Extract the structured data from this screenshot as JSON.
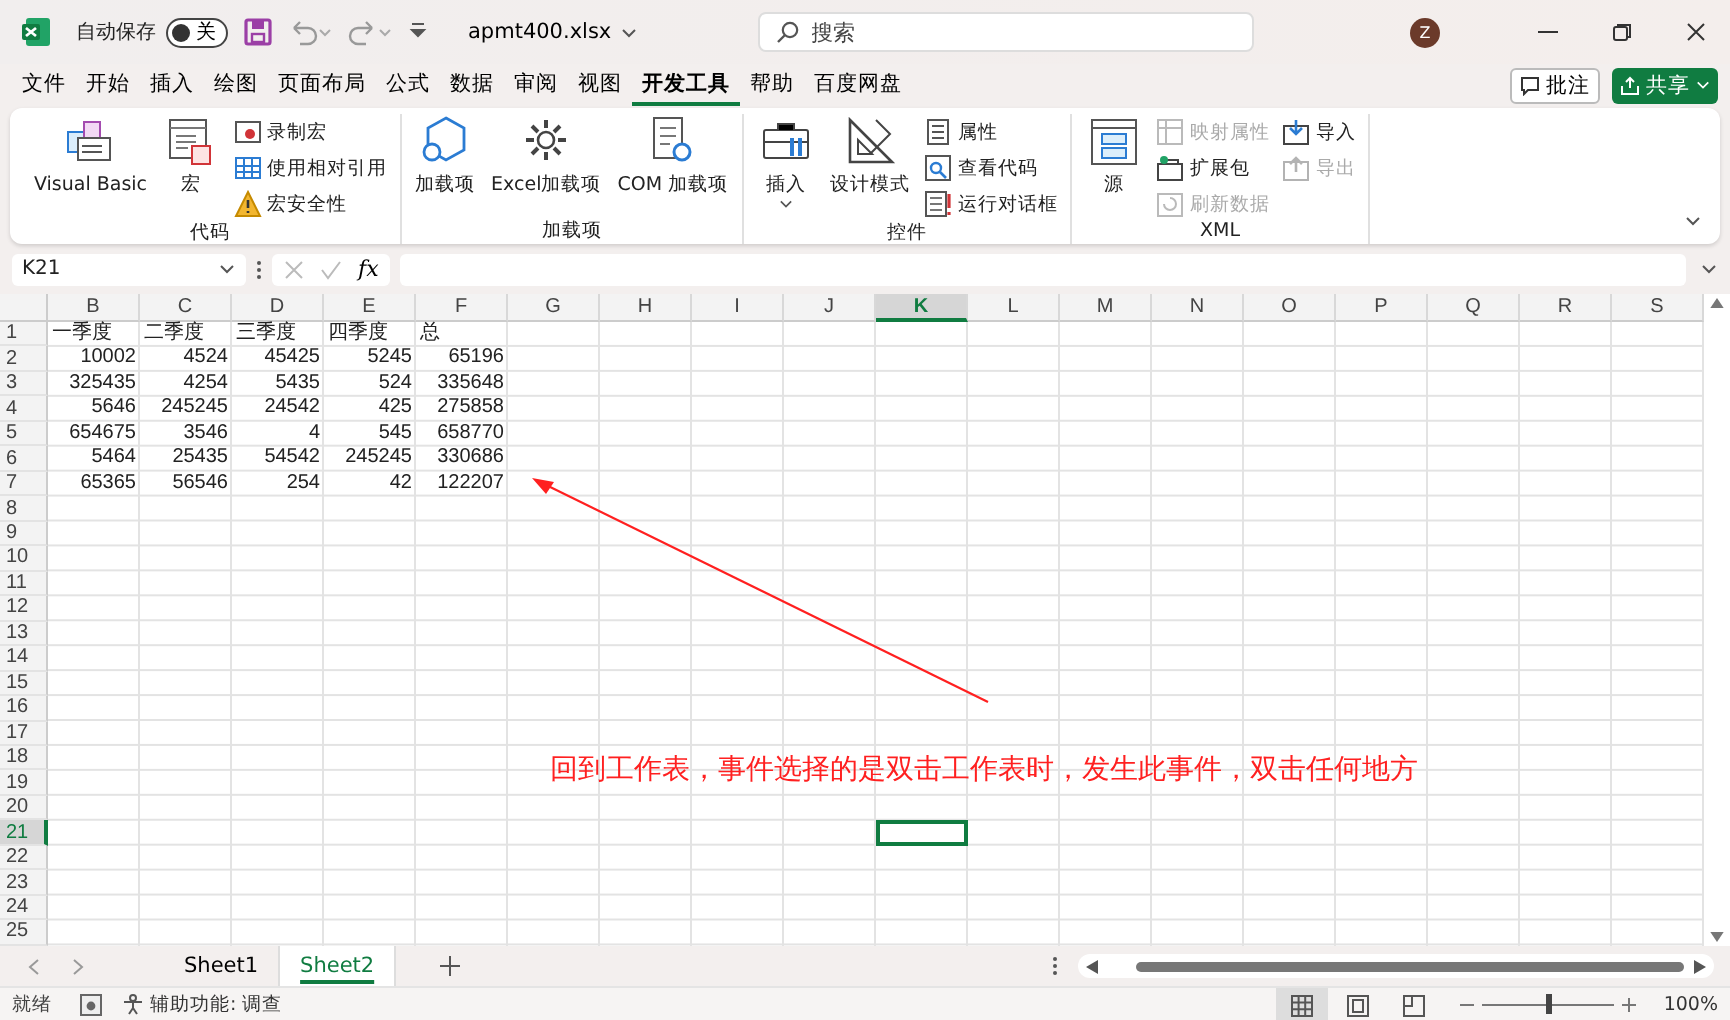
{
  "title_bar": {
    "autosave_label": "自动保存",
    "autosave_toggle": {
      "label": "关",
      "on": false
    },
    "file_name": "apmt400.xlsx",
    "search": {
      "placeholder": "搜索"
    },
    "avatar": "Z"
  },
  "menu_tabs": [
    {
      "label": "文件",
      "selected": false
    },
    {
      "label": "开始",
      "selected": false
    },
    {
      "label": "插入",
      "selected": false
    },
    {
      "label": "绘图",
      "selected": false
    },
    {
      "label": "页面布局",
      "selected": false
    },
    {
      "label": "公式",
      "selected": false
    },
    {
      "label": "数据",
      "selected": false
    },
    {
      "label": "审阅",
      "selected": false
    },
    {
      "label": "视图",
      "selected": false
    },
    {
      "label": "开发工具",
      "selected": true
    },
    {
      "label": "帮助",
      "selected": false
    },
    {
      "label": "百度网盘",
      "selected": false
    }
  ],
  "comment_button": "批注",
  "share_button": "共享",
  "ribbon": [
    {
      "title": "代码",
      "items": [
        {
          "kind": "large",
          "lines": [
            "Visual Basic"
          ],
          "disabled": false
        },
        {
          "kind": "large",
          "lines": [
            "宏"
          ],
          "disabled": false
        },
        {
          "kind": "small",
          "label": "录制宏",
          "disabled": false
        },
        {
          "kind": "small",
          "label": "使用相对引用",
          "disabled": false
        },
        {
          "kind": "small",
          "label": "宏安全性",
          "disabled": false
        }
      ]
    },
    {
      "title": "加载项",
      "items": [
        {
          "kind": "large",
          "lines": [
            "加",
            "载项"
          ],
          "disabled": false
        },
        {
          "kind": "large",
          "lines": [
            "Excel",
            "加载项"
          ],
          "disabled": false
        },
        {
          "kind": "large",
          "lines": [
            "COM 加载项"
          ],
          "disabled": false
        }
      ]
    },
    {
      "title": "控件",
      "items": [
        {
          "kind": "menu",
          "lines": [
            "插入"
          ],
          "disabled": false
        },
        {
          "kind": "large",
          "lines": [
            "设计模式"
          ],
          "disabled": false
        },
        {
          "kind": "small",
          "label": "属性",
          "disabled": false
        },
        {
          "kind": "small",
          "label": "查看代码",
          "disabled": false
        },
        {
          "kind": "small",
          "label": "运行对话框",
          "disabled": false
        }
      ]
    },
    {
      "title": "XML",
      "items": [
        {
          "kind": "large",
          "lines": [
            "源"
          ],
          "disabled": false
        },
        {
          "kind": "small",
          "label": "映射属性",
          "disabled": true
        },
        {
          "kind": "small",
          "label": "扩展包",
          "disabled": false
        },
        {
          "kind": "small",
          "label": "刷新数据",
          "disabled": true
        },
        {
          "kind": "small",
          "label": "导入",
          "disabled": false
        },
        {
          "kind": "small",
          "label": "导出",
          "disabled": true
        }
      ]
    }
  ],
  "formula_bar": {
    "name_box": "K21",
    "function_label": "fx"
  },
  "columns": [
    {
      "label": "B",
      "selected": false
    },
    {
      "label": "C",
      "selected": false
    },
    {
      "label": "D",
      "selected": false
    },
    {
      "label": "E",
      "selected": false
    },
    {
      "label": "F",
      "selected": false
    },
    {
      "label": "G",
      "selected": false
    },
    {
      "label": "H",
      "selected": false
    },
    {
      "label": "I",
      "selected": false
    },
    {
      "label": "J",
      "selected": false
    },
    {
      "label": "K",
      "selected": true
    },
    {
      "label": "L",
      "selected": false
    },
    {
      "label": "M",
      "selected": false
    },
    {
      "label": "N",
      "selected": false
    },
    {
      "label": "O",
      "selected": false
    },
    {
      "label": "P",
      "selected": false
    },
    {
      "label": "Q",
      "selected": false
    },
    {
      "label": "R",
      "selected": false
    },
    {
      "label": "S",
      "selected": false
    }
  ],
  "rows": [
    {
      "label": "1",
      "selected": false,
      "kind": "text",
      "cells": [
        "一季度",
        "二季度",
        "三季度",
        "四季度",
        "总"
      ]
    },
    {
      "label": "2",
      "selected": false,
      "kind": "number",
      "cells": [
        "10002",
        "4524",
        "45425",
        "5245",
        "65196"
      ]
    },
    {
      "label": "3",
      "selected": false,
      "kind": "number",
      "cells": [
        "325435",
        "4254",
        "5435",
        "524",
        "335648"
      ]
    },
    {
      "label": "4",
      "selected": false,
      "kind": "number",
      "cells": [
        "5646",
        "245245",
        "24542",
        "425",
        "275858"
      ]
    },
    {
      "label": "5",
      "selected": false,
      "kind": "number",
      "cells": [
        "654675",
        "3546",
        "4",
        "545",
        "658770"
      ]
    },
    {
      "label": "6",
      "selected": false,
      "kind": "number",
      "cells": [
        "5464",
        "25435",
        "54542",
        "245245",
        "330686"
      ]
    },
    {
      "label": "7",
      "selected": false,
      "kind": "number",
      "cells": [
        "65365",
        "56546",
        "254",
        "42",
        "122207"
      ]
    },
    {
      "label": "8",
      "selected": false
    },
    {
      "label": "9",
      "selected": false
    },
    {
      "label": "10",
      "selected": false
    },
    {
      "label": "11",
      "selected": false
    },
    {
      "label": "12",
      "selected": false
    },
    {
      "label": "13",
      "selected": false
    },
    {
      "label": "14",
      "selected": false
    },
    {
      "label": "15",
      "selected": false
    },
    {
      "label": "16",
      "selected": false
    },
    {
      "label": "17",
      "selected": false
    },
    {
      "label": "18",
      "selected": false
    },
    {
      "label": "19",
      "selected": false
    },
    {
      "label": "20",
      "selected": false
    },
    {
      "label": "21",
      "selected": true
    },
    {
      "label": "22",
      "selected": false
    },
    {
      "label": "23",
      "selected": false
    },
    {
      "label": "24",
      "selected": false
    },
    {
      "label": "25",
      "selected": false
    }
  ],
  "annotation": "回到工作表，事件选择的是双击工作表时，发生此事件，双击任何地方",
  "sheet_tabs": [
    {
      "label": "Sheet1",
      "selected": false
    },
    {
      "label": "Sheet2",
      "selected": true
    }
  ],
  "status_bar": {
    "state": "就绪",
    "accessibility": "辅助功能: 调查",
    "views": [
      {
        "selected": true
      },
      {
        "selected": false
      },
      {
        "selected": false
      }
    ],
    "zoom": {
      "level": 0.5,
      "label": "100%"
    }
  }
}
